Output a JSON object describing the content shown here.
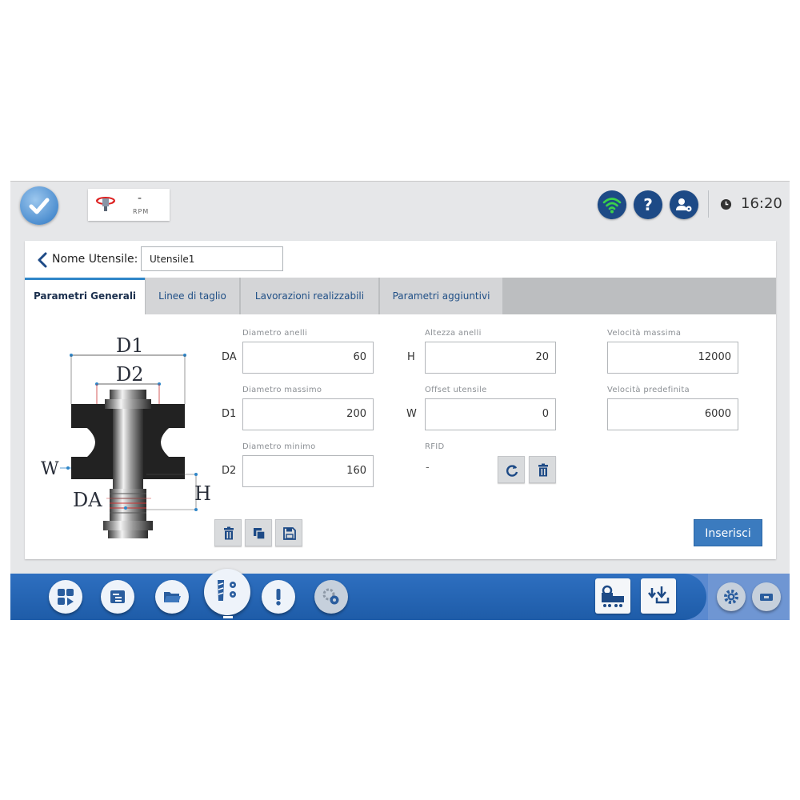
{
  "status": {
    "rpm_value": "-",
    "rpm_label": "RPM",
    "time": "16:20"
  },
  "header": {
    "title_label": "Nome Utensile:",
    "name_value": "Utensile1"
  },
  "tabs": [
    {
      "label": "Parametri Generali"
    },
    {
      "label": "Linee di taglio"
    },
    {
      "label": "Lavorazioni realizzabili"
    },
    {
      "label": "Parametri aggiuntivi"
    }
  ],
  "diagram": {
    "D1": "D1",
    "D2": "D2",
    "W": "W",
    "DA": "DA",
    "H": "H"
  },
  "params": {
    "diametro_anelli": {
      "label": "Diametro anelli",
      "code": "DA",
      "value": "60"
    },
    "altezza_anelli": {
      "label": "Altezza anelli",
      "code": "H",
      "value": "20"
    },
    "velocita_massima": {
      "label": "Velocità massima",
      "value": "12000"
    },
    "diametro_massimo": {
      "label": "Diametro massimo",
      "code": "D1",
      "value": "200"
    },
    "offset_utensile": {
      "label": "Offset utensile",
      "code": "W",
      "value": "0"
    },
    "velocita_predefinita": {
      "label": "Velocità predefinita",
      "value": "6000"
    },
    "diametro_minimo": {
      "label": "Diametro minimo",
      "code": "D2",
      "value": "160"
    },
    "rfid": {
      "label": "RFID",
      "value": "-"
    }
  },
  "actions": {
    "insert_label": "Inserisci"
  },
  "icons": [
    "check-icon",
    "spindle-icon",
    "wifi-icon",
    "help-icon",
    "user-settings-icon",
    "clock-icon",
    "back-chevron-icon",
    "refresh-icon",
    "trash-icon",
    "copy-icon",
    "save-icon",
    "dashboard-icon",
    "program-list-icon",
    "folder-icon",
    "tool-icon",
    "alert-icon",
    "settings-icon",
    "lock-machine-icon",
    "download-icon",
    "gear-icon",
    "display-icon"
  ],
  "colors": {
    "accent": "#2f86c8",
    "primary_button": "#3b7bbf",
    "dock": "#1e5ca8",
    "status_icon": "#1d4a86"
  }
}
